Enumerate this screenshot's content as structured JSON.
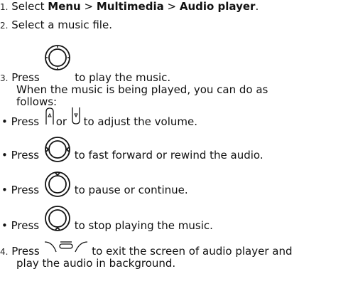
{
  "steps": {
    "s1": {
      "num": "1.",
      "pre": "Select ",
      "menu": "Menu",
      "sep1": " > ",
      "mm": "Multimedia",
      "sep2": " > ",
      "ap": "Audio player",
      "post": "."
    },
    "s2": {
      "num": "2.",
      "text": "Select a music file."
    },
    "s3": {
      "num": "3.",
      "pre": "Press",
      "post": "to play the music."
    },
    "s3_para_1": "When the music is being played, you can do as",
    "s3_para_2": "follows:",
    "s4": {
      "num": "4.",
      "pre": "Press",
      "post": "to exit the screen of audio player and",
      "cont": "play the audio in background."
    }
  },
  "bullets": [
    {
      "pre": "Press",
      "or": "or",
      "post": "to adjust the volume."
    },
    {
      "pre": "Press",
      "post": "to fast forward or rewind the audio."
    },
    {
      "pre": "Press",
      "post": "to pause or continue."
    },
    {
      "pre": "Press",
      "post": "to stop playing the music."
    }
  ],
  "icons": {
    "play": "nav-key-center-icon",
    "vol_up": "volume-up-key-icon",
    "vol_down": "volume-down-key-icon",
    "seek": "nav-key-left-right-icon",
    "pause": "nav-key-up-icon",
    "stop": "nav-key-down-icon",
    "back": "end-back-key-icon"
  },
  "bullet_char": "•"
}
